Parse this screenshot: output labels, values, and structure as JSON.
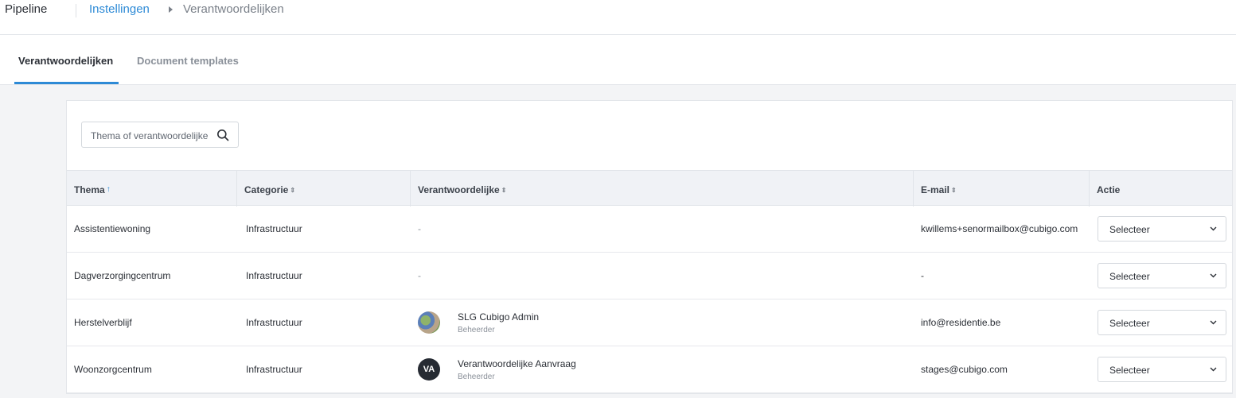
{
  "app": {
    "name": "Pipeline"
  },
  "breadcrumb": {
    "parent": "Instellingen",
    "current": "Verantwoordelijken"
  },
  "tabs": [
    {
      "label": "Verantwoordelijken",
      "active": true
    },
    {
      "label": "Document templates",
      "active": false
    }
  ],
  "search": {
    "placeholder": "Thema of verantwoordelijke"
  },
  "table": {
    "columns": [
      {
        "label": "Thema",
        "sort": "ascending"
      },
      {
        "label": "Categorie",
        "sort": "sortable"
      },
      {
        "label": "Verantwoordelijke",
        "sort": "sortable"
      },
      {
        "label": "E-mail",
        "sort": "sortable"
      },
      {
        "label": "Actie",
        "sort": "none"
      }
    ],
    "rows": [
      {
        "thema": "Assistentiewoning",
        "categorie": "Infrastructuur",
        "verantwoordelijke": "-",
        "email": "kwillems+senormailbox@cubigo.com",
        "actie": "Selecteer"
      },
      {
        "thema": "Dagverzorgingcentrum",
        "categorie": "Infrastructuur",
        "verantwoordelijke": "-",
        "email": "-",
        "actie": "Selecteer"
      },
      {
        "thema": "Herstelverblijf",
        "categorie": "Infrastructuur",
        "verantwoordelijke": {
          "name": "SLG Cubigo Admin",
          "role": "Beheerder",
          "avatar": "photo"
        },
        "email": "info@residentie.be",
        "actie": "Selecteer"
      },
      {
        "thema": "Woonzorgcentrum",
        "categorie": "Infrastructuur",
        "verantwoordelijke": {
          "name": "Verantwoordelijke Aanvraag",
          "role": "Beheerder",
          "avatar_initials": "VA"
        },
        "email": "stages@cubigo.com",
        "actie": "Selecteer"
      }
    ]
  },
  "colors": {
    "accent": "#2d8ad6",
    "header_bg": "#f0f2f6",
    "page_bg": "#f3f4f6"
  }
}
